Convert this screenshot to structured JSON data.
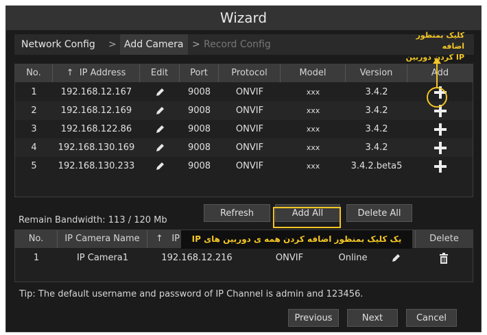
{
  "window": {
    "title": "Wizard"
  },
  "tabs": [
    {
      "label": "Network Config"
    },
    {
      "label": "Add Camera"
    },
    {
      "label": "Record Config"
    }
  ],
  "annotations": {
    "add_ip_line1": "کلیک بمنظور اضافه",
    "add_ip_line2": "کردن دوربین IP",
    "add_all": "یک کلیک بمنظور اضافه کردن همه ی دوربین های IP"
  },
  "search_table": {
    "headers": [
      "No.",
      "IP Address",
      "Edit",
      "Port",
      "Protocol",
      "Model",
      "Version",
      "Add"
    ],
    "sort_arrow": "↑",
    "rows": [
      {
        "no": "1",
        "ip": "192.168.12.167",
        "port": "9008",
        "protocol": "ONVIF",
        "model": "xxx",
        "version": "3.4.2"
      },
      {
        "no": "2",
        "ip": "192.168.12.169",
        "port": "9008",
        "protocol": "ONVIF",
        "model": "xxx",
        "version": "3.4.2"
      },
      {
        "no": "3",
        "ip": "192.168.122.86",
        "port": "9008",
        "protocol": "ONVIF",
        "model": "xxx",
        "version": "3.4.2"
      },
      {
        "no": "4",
        "ip": "192.168.130.169",
        "port": "9008",
        "protocol": "ONVIF",
        "model": "xxx",
        "version": "3.4.2"
      },
      {
        "no": "5",
        "ip": "192.168.130.233",
        "port": "9008",
        "protocol": "ONVIF",
        "model": "xxx",
        "version": "3.4.2.beta5"
      }
    ]
  },
  "actions": {
    "refresh": "Refresh",
    "add_all": "Add All",
    "delete_all": "Delete All"
  },
  "bandwidth": "Remain Bandwidth: 113 / 120 Mb",
  "added_table": {
    "headers": [
      "No.",
      "IP Camera Name",
      "IP",
      "Delete"
    ],
    "sort_arrow": "↑",
    "rows": [
      {
        "no": "1",
        "name": "IP Camera1",
        "ip": "192.168.12.216",
        "protocol": "ONVIF",
        "status": "Online"
      }
    ]
  },
  "tip": "Tip: The default username and password of IP Channel is admin and 123456.",
  "footer": {
    "previous": "Previous",
    "next": "Next",
    "cancel": "Cancel"
  },
  "colors": {
    "accent": "#f3c625",
    "background": "#1b1b1b",
    "header": "#3b3b3b"
  }
}
